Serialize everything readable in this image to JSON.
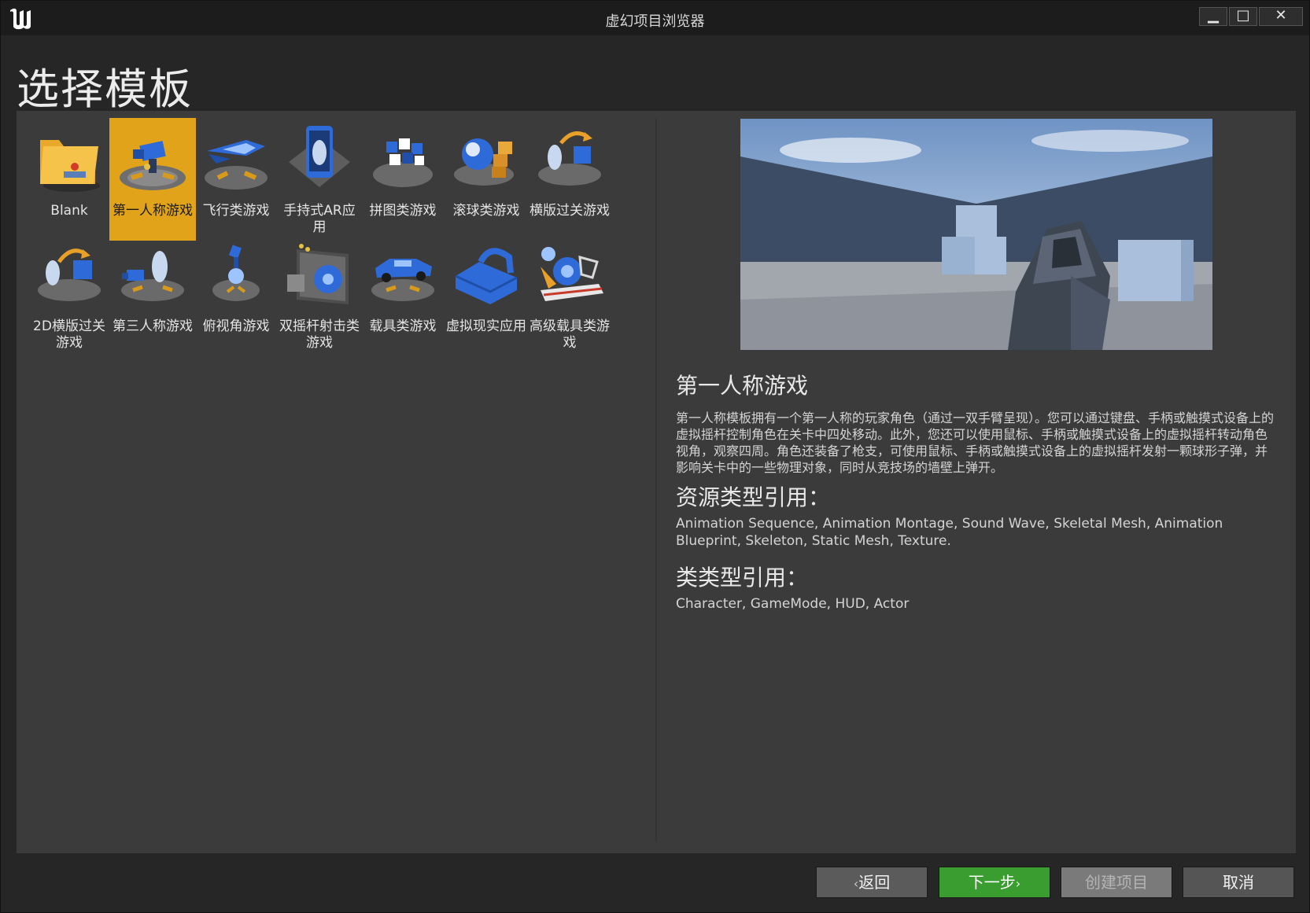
{
  "window": {
    "title": "虚幻项目浏览器"
  },
  "page": {
    "heading": "选择模板"
  },
  "templates": [
    {
      "label": "Blank",
      "icon": "folder-icon",
      "selected": false
    },
    {
      "label": "第一人称游戏",
      "icon": "first-person-camera-icon",
      "selected": true
    },
    {
      "label": "飞行类游戏",
      "icon": "spaceship-icon",
      "selected": false
    },
    {
      "label": "手持式AR应用",
      "icon": "phone-ar-icon",
      "selected": false
    },
    {
      "label": "拼图类游戏",
      "icon": "puzzle-blocks-icon",
      "selected": false
    },
    {
      "label": "滚球类游戏",
      "icon": "rolling-ball-icon",
      "selected": false
    },
    {
      "label": "横版过关游戏",
      "icon": "side-scroller-icon",
      "selected": false
    },
    {
      "label": "2D横版过关游戏",
      "icon": "side-scroller-2d-icon",
      "selected": false
    },
    {
      "label": "第三人称游戏",
      "icon": "third-person-camera-icon",
      "selected": false
    },
    {
      "label": "俯视角游戏",
      "icon": "top-down-icon",
      "selected": false
    },
    {
      "label": "双摇杆射击类游戏",
      "icon": "twin-stick-ship-icon",
      "selected": false
    },
    {
      "label": "载具类游戏",
      "icon": "car-icon",
      "selected": false
    },
    {
      "label": "虚拟现实应用",
      "icon": "vr-headset-icon",
      "selected": false
    },
    {
      "label": "高级载具类游戏",
      "icon": "advanced-vehicle-icon",
      "selected": false
    }
  ],
  "details": {
    "title": "第一人称游戏",
    "description": "第一人称模板拥有一个第一人称的玩家角色（通过一双手臂呈现）。您可以通过键盘、手柄或触摸式设备上的虚拟摇杆控制角色在关卡中四处移动。此外，您还可以使用鼠标、手柄或触摸式设备上的虚拟摇杆转动角色视角，观察四周。角色还装备了枪支，可使用鼠标、手柄或触摸式设备上的虚拟摇杆发射一颗球形子弹，并影响关卡中的一些物理对象，同时从竞技场的墙壁上弹开。",
    "asset_heading": "资源类型引用：",
    "asset_types": "Animation Sequence, Animation Montage, Sound Wave, Skeletal Mesh, Animation Blueprint, Skeleton, Static Mesh, Texture.",
    "class_heading": "类类型引用：",
    "class_types": "Character, GameMode, HUD, Actor"
  },
  "buttons": {
    "back": "返回",
    "next": "下一步",
    "create": "创建项目",
    "cancel": "取消"
  },
  "colors": {
    "selected": "#e0a31a",
    "next_button": "#3a9d2f",
    "panel": "#3b3b3b",
    "icon_blue": "#2f6bd8"
  }
}
